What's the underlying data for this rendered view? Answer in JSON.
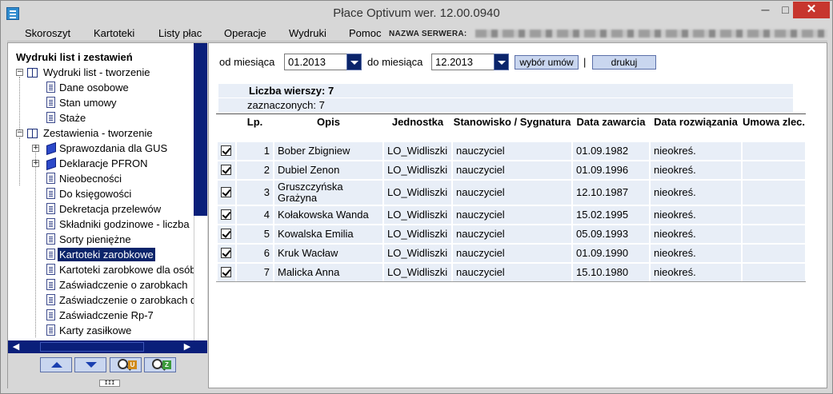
{
  "window": {
    "title": "Płace Optivum wer. 12.00.0940",
    "minimize": "─",
    "maximize": "□",
    "close": "✕"
  },
  "menu": {
    "items": [
      "Skoroszyt",
      "Kartoteki",
      "Listy płac",
      "Operacje",
      "Wydruki",
      "Pomoc"
    ],
    "server_label": "NAZWA SERWERA:"
  },
  "tree": {
    "title": "Wydruki list i zestawień",
    "nodes": [
      {
        "label": "Wydruki list - tworzenie",
        "icon": "book-icon",
        "expanded": true
      },
      {
        "label": "Dane osobowe",
        "icon": "document-icon"
      },
      {
        "label": "Stan umowy",
        "icon": "document-icon"
      },
      {
        "label": "Staże",
        "icon": "document-icon"
      },
      {
        "label": "Zestawienia - tworzenie",
        "icon": "book-icon",
        "expanded": true
      },
      {
        "label": "Sprawozdania dla GUS",
        "icon": "folder-blue-icon",
        "expanded": false
      },
      {
        "label": "Deklaracje PFRON",
        "icon": "folder-blue-icon",
        "expanded": false
      },
      {
        "label": "Nieobecności",
        "icon": "document-icon"
      },
      {
        "label": "Do księgowości",
        "icon": "document-icon"
      },
      {
        "label": "Dekretacja przelewów",
        "icon": "document-icon"
      },
      {
        "label": "Składniki godzinowe - liczba",
        "icon": "document-icon"
      },
      {
        "label": "Sorty pieniężne",
        "icon": "document-icon"
      },
      {
        "label": "Kartoteki zarobkowe",
        "icon": "document-icon",
        "selected": true
      },
      {
        "label": "Kartoteki zarobkowe dla osób",
        "icon": "document-icon"
      },
      {
        "label": "Zaświadczenie o zarobkach",
        "icon": "document-icon"
      },
      {
        "label": "Zaświadczenie o zarobkach d",
        "icon": "document-icon"
      },
      {
        "label": "Zaświadczenie Rp-7",
        "icon": "document-icon"
      },
      {
        "label": "Karty zasiłkowe",
        "icon": "document-icon"
      }
    ],
    "expander_minus": "−",
    "expander_plus": "+",
    "scroll_left": "◀",
    "scroll_right": "▶",
    "grip": "III"
  },
  "nav_buttons": [
    {
      "name": "move-up-button",
      "icon": "arrow-up-icon"
    },
    {
      "name": "move-down-button",
      "icon": "arrow-down-icon"
    },
    {
      "name": "search-u-button",
      "icon": "magnifier-u-icon",
      "badge": "U",
      "badge_color": "#d08a1a"
    },
    {
      "name": "search-z-button",
      "icon": "magnifier-z-icon",
      "badge": "Z",
      "badge_color": "#3b9a3b"
    }
  ],
  "filters": {
    "from_label": "od miesiąca",
    "from_value": "01.2013",
    "to_label": "do miesiąca",
    "to_value": "12.2013",
    "select_contracts": "wybór umów",
    "separator": "|",
    "print": "drukuj"
  },
  "summary": {
    "row_count": "Liczba wierszy: 7",
    "selected_count": "zaznaczonych: 7"
  },
  "table": {
    "columns": [
      "",
      "Lp.",
      "Opis",
      "Jednostka",
      "Stanowisko / Sygnatura",
      "Data zawarcia",
      "Data rozwiązania",
      "Umowa zlec."
    ],
    "rows": [
      {
        "checked": true,
        "lp": "1",
        "opis": "Bober Zbigniew",
        "jednostka": "LO_Widliszki",
        "stanowisko": "nauczyciel",
        "data_zawarcia": "01.09.1982",
        "data_rozwiazania": "nieokreś.",
        "umowa": ""
      },
      {
        "checked": true,
        "lp": "2",
        "opis": "Dubiel Zenon",
        "jednostka": "LO_Widliszki",
        "stanowisko": "nauczyciel",
        "data_zawarcia": "01.09.1996",
        "data_rozwiazania": "nieokreś.",
        "umowa": ""
      },
      {
        "checked": true,
        "lp": "3",
        "opis": "Gruszczyńska Grażyna",
        "jednostka": "LO_Widliszki",
        "stanowisko": "nauczyciel",
        "data_zawarcia": "12.10.1987",
        "data_rozwiazania": "nieokreś.",
        "umowa": ""
      },
      {
        "checked": true,
        "lp": "4",
        "opis": "Kołakowska Wanda",
        "jednostka": "LO_Widliszki",
        "stanowisko": "nauczyciel",
        "data_zawarcia": "15.02.1995",
        "data_rozwiazania": "nieokreś.",
        "umowa": ""
      },
      {
        "checked": true,
        "lp": "5",
        "opis": "Kowalska Emilia",
        "jednostka": "LO_Widliszki",
        "stanowisko": "nauczyciel",
        "data_zawarcia": "05.09.1993",
        "data_rozwiazania": "nieokreś.",
        "umowa": ""
      },
      {
        "checked": true,
        "lp": "6",
        "opis": "Kruk Wacław",
        "jednostka": "LO_Widliszki",
        "stanowisko": "nauczyciel",
        "data_zawarcia": "01.09.1990",
        "data_rozwiazania": "nieokreś.",
        "umowa": ""
      },
      {
        "checked": true,
        "lp": "7",
        "opis": "Malicka Anna",
        "jednostka": "LO_Widliszki",
        "stanowisko": "nauczyciel",
        "data_zawarcia": "15.10.1980",
        "data_rozwiazania": "nieokreś.",
        "umowa": ""
      }
    ]
  },
  "colors": {
    "selection": "#0a246a",
    "row_background": "#e8eef7",
    "button_face": "#c9d6ef",
    "close_button": "#c7362e"
  }
}
